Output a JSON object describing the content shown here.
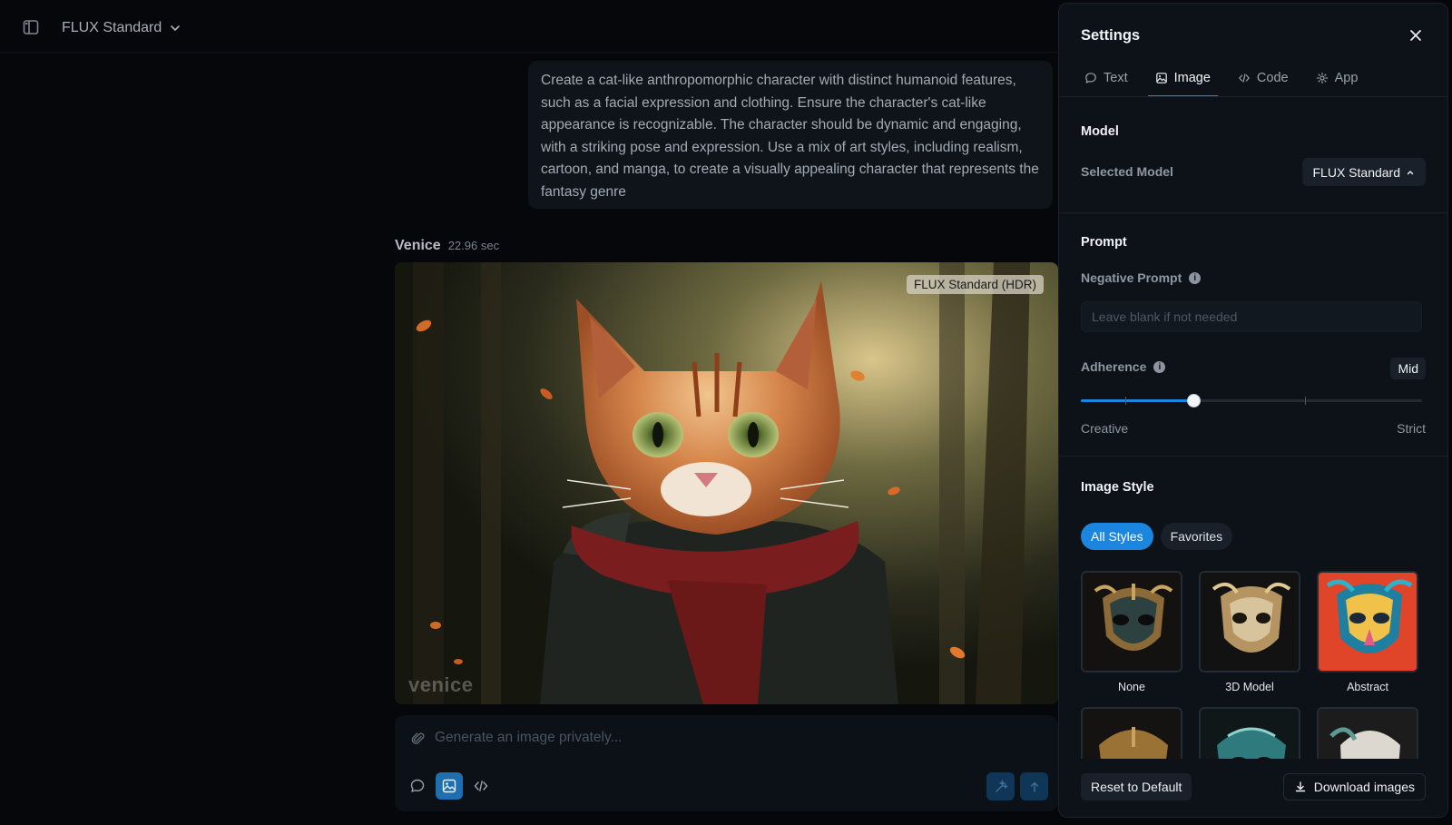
{
  "header": {
    "model_name": "FLUX Standard",
    "sidebar_icon": "sidebar-toggle-icon",
    "dropdown_icon": "chevron-down-icon"
  },
  "chat": {
    "user_prompt": "Create a cat-like anthropomorphic character with distinct humanoid features, such as a facial expression and clothing. Ensure the character's cat-like appearance is recognizable. The character should be dynamic and engaging, with a striking pose and expression. Use a mix of art styles, including realism, cartoon, and manga, to create a visually appealing character that represents the fantasy genre",
    "reply_author": "Venice",
    "reply_time": "22.96 sec",
    "image_badge": "FLUX Standard (HDR)",
    "watermark": "venice"
  },
  "composer": {
    "placeholder": "Generate an image privately...",
    "modes": [
      "text",
      "image",
      "code"
    ],
    "active_mode": "image"
  },
  "settings": {
    "title": "Settings",
    "tabs": [
      {
        "label": "Text",
        "icon": "chat-bubble-icon"
      },
      {
        "label": "Image",
        "icon": "image-icon"
      },
      {
        "label": "Code",
        "icon": "code-icon"
      },
      {
        "label": "App",
        "icon": "gear-icon"
      }
    ],
    "active_tab": "Image",
    "model_section": {
      "title": "Model",
      "selected_label": "Selected Model",
      "selected_value": "FLUX Standard"
    },
    "prompt_section": {
      "title": "Prompt",
      "negative_label": "Negative Prompt",
      "negative_placeholder": "Leave blank if not needed",
      "adherence_label": "Adherence",
      "adherence_value": "Mid",
      "adherence_level": 0.33,
      "adherence_min_label": "Creative",
      "adherence_max_label": "Strict"
    },
    "style_section": {
      "title": "Image Style",
      "filters": [
        "All Styles",
        "Favorites"
      ],
      "active_filter": "All Styles",
      "styles": [
        {
          "label": "None"
        },
        {
          "label": "3D Model"
        },
        {
          "label": "Abstract"
        },
        {
          "label": ""
        },
        {
          "label": ""
        },
        {
          "label": ""
        }
      ]
    },
    "footer": {
      "reset_label": "Reset to Default",
      "download_label": "Download images"
    }
  },
  "colors": {
    "accent": "#1b86e0",
    "panel_bg": "#0d1218",
    "page_bg": "#05070b"
  }
}
